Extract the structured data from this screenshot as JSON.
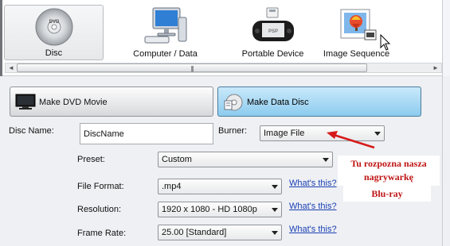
{
  "categories": [
    {
      "label": "Disc",
      "icon": "dvd-disc-icon",
      "selected": true
    },
    {
      "label": "Computer / Data",
      "icon": "computer-icon",
      "selected": false
    },
    {
      "label": "Portable Device",
      "icon": "psp-device-icon",
      "selected": false
    },
    {
      "label": "Image Sequence",
      "icon": "image-sequence-icon",
      "selected": false
    }
  ],
  "scrollbar": {
    "left_arrow": "◄",
    "right_arrow": "►",
    "grip": "|||"
  },
  "modes": {
    "dvd_movie": "Make DVD Movie",
    "data_disc": "Make Data Disc",
    "active": "data_disc"
  },
  "form": {
    "disc_name_label": "Disc Name:",
    "disc_name_value": "DiscName",
    "burner_label": "Burner:",
    "burner_value": "Image File",
    "preset_label": "Preset:",
    "preset_value": "Custom",
    "file_format_label": "File Format:",
    "file_format_value": ".mp4",
    "resolution_label": "Resolution:",
    "resolution_value": "1920 x 1080 - HD 1080p",
    "frame_rate_label": "Frame Rate:",
    "frame_rate_value": "25.00 [Standard]",
    "whats_this": "What's this?"
  },
  "annotations": {
    "note_line1": "Tu rozpozna nasza",
    "note_line2": "nagrywarkę",
    "note_bluray": "Blu-ray",
    "arrow_color": "#d61a1a"
  },
  "colors": {
    "accent_blue": "#8ccbee",
    "link": "#1a3fb5",
    "annotation_red": "#c01414"
  }
}
